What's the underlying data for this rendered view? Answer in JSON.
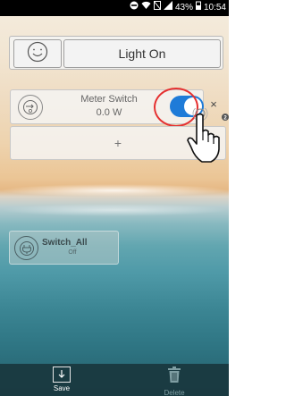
{
  "status_bar": {
    "battery": "43%",
    "time": "10:54"
  },
  "scene_bar": {
    "scene_icon": "smiley-face-icon",
    "scene_label": "Light On"
  },
  "devices": [
    {
      "name": "Meter Switch",
      "value": "0.0 W",
      "icon": "meter-icon",
      "toggle_on": true,
      "close_label": "×"
    }
  ],
  "add_label": "+",
  "groups": [
    {
      "name": "Switch_All",
      "state": "Off",
      "icon": "plug-icon"
    }
  ],
  "bottom_bar": {
    "save_label": "Save",
    "delete_label": "Delete"
  },
  "colors": {
    "toggle_on": "#1e7bd8",
    "highlight_ring": "#e53030"
  }
}
